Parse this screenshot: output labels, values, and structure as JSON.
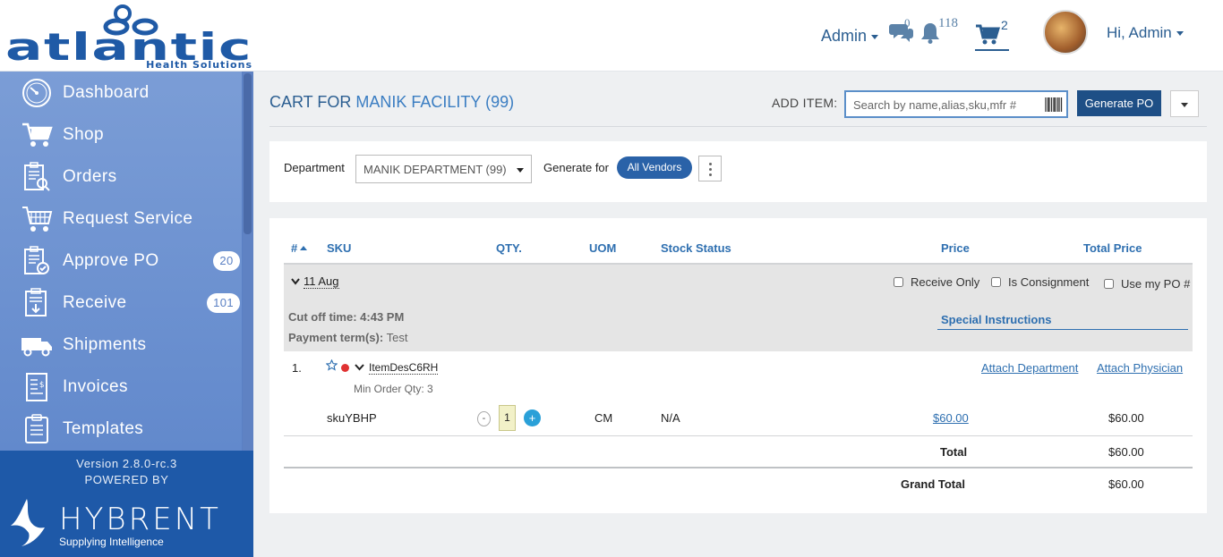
{
  "header": {
    "logo_text": "atlantic",
    "logo_sub": "Health Solutions",
    "admin_menu": "Admin",
    "chat_count": "0",
    "notification_count": "118",
    "cart_count": "2",
    "user_greeting": "Hi, Admin"
  },
  "sidebar": {
    "items": [
      {
        "label": "Dashboard",
        "icon": "dashboard-icon"
      },
      {
        "label": "Shop",
        "icon": "cart-icon"
      },
      {
        "label": "Orders",
        "icon": "orders-icon"
      },
      {
        "label": "Request Service",
        "icon": "request-service-icon"
      },
      {
        "label": "Approve PO",
        "icon": "approve-po-icon",
        "badge": "20"
      },
      {
        "label": "Receive",
        "icon": "receive-icon",
        "badge": "101"
      },
      {
        "label": "Shipments",
        "icon": "truck-icon"
      },
      {
        "label": "Invoices",
        "icon": "invoice-icon"
      },
      {
        "label": "Templates",
        "icon": "templates-icon"
      }
    ],
    "version": "Version 2.8.0-rc.3",
    "powered_by": "POWERED BY",
    "brand": "HYBRENT",
    "brand_tagline": "Supplying Intelligence"
  },
  "main": {
    "title_prefix": "CART FOR",
    "facility": "MANIK FACILITY (99)",
    "add_item_label": "ADD ITEM:",
    "search_placeholder": "Search by name,alias,sku,mfr #",
    "generate_po": "Generate PO",
    "department_label": "Department",
    "department_value": "MANIK DEPARTMENT (99)",
    "generate_for_label": "Generate for",
    "vendor_chip": "All Vendors"
  },
  "table": {
    "columns": {
      "num": "#",
      "sku": "SKU",
      "qty": "QTY.",
      "uom": "UOM",
      "stock": "Stock Status",
      "price": "Price",
      "total": "Total Price"
    },
    "group": {
      "date": "11 Aug",
      "receive_only": "Receive Only",
      "is_consignment": "Is Consignment",
      "use_my_po": "Use my PO #",
      "cutoff_label": "Cut off time:",
      "cutoff_value": "4:43 PM",
      "payment_label": "Payment term(s):",
      "payment_value": "Test",
      "special_instructions": "Special Instructions"
    },
    "rows": [
      {
        "num": "1.",
        "item": "ItemDesC6RH",
        "min_order": "Min Order Qty: 3",
        "attach_department": "Attach Department",
        "attach_physician": "Attach Physician",
        "sku": "skuYBHP",
        "qty": "1",
        "uom": "CM",
        "stock": "N/A",
        "price": "$60.00",
        "total": "$60.00"
      }
    ],
    "total_label": "Total",
    "total_value": "$60.00",
    "grand_total_label": "Grand Total",
    "grand_total_value": "$60.00"
  },
  "colors": {
    "brand_blue": "#1e4f86",
    "sidebar": "#6289cc",
    "link": "#2e6fb0",
    "badge_red": "#e03232"
  }
}
